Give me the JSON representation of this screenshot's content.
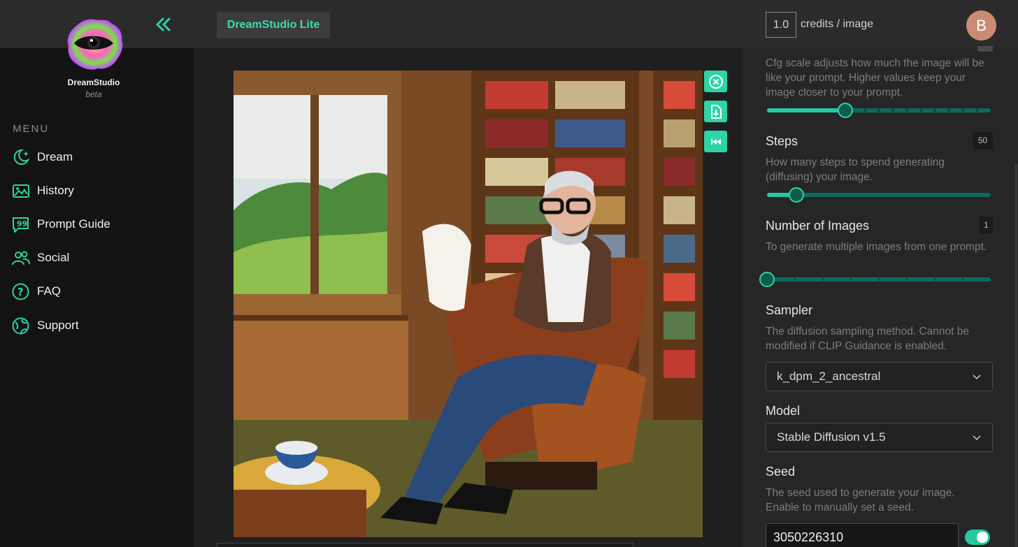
{
  "sidebar": {
    "brand_name": "DreamStudio",
    "brand_sub": "beta",
    "menu_heading": "MENU",
    "items": [
      {
        "label": "Dream",
        "icon": "dream-icon"
      },
      {
        "label": "History",
        "icon": "history-icon"
      },
      {
        "label": "Prompt Guide",
        "icon": "prompt-guide-icon"
      },
      {
        "label": "Social",
        "icon": "social-icon"
      },
      {
        "label": "FAQ",
        "icon": "faq-icon"
      },
      {
        "label": "Support",
        "icon": "support-icon"
      }
    ]
  },
  "header": {
    "app_label": "DreamStudio Lite"
  },
  "account": {
    "credits_value": "1.0",
    "credits_label": "credits / image",
    "avatar_initial": "B"
  },
  "settings": {
    "cfg": {
      "description": "Cfg scale adjusts how much the image will be like your prompt. Higher values keep your image closer to your prompt.",
      "level": 0.35
    },
    "steps": {
      "title": "Steps",
      "value": "50",
      "description": "How many steps to spend generating (diffusing) your image.",
      "level": 0.13
    },
    "images": {
      "title": "Number of Images",
      "value": "1",
      "description": "To generate multiple images from one prompt.",
      "level": 0.0
    },
    "sampler": {
      "title": "Sampler",
      "description": "The diffusion sampling method. Cannot be modified if CLIP Guidance is enabled.",
      "selected": "k_dpm_2_ancestral"
    },
    "model": {
      "title": "Model",
      "selected": "Stable Diffusion v1.5"
    },
    "seed": {
      "title": "Seed",
      "description": "The seed used to generate your image. Enable to manually set a seed.",
      "value": "3050226310",
      "enabled": true
    }
  },
  "image_actions": [
    "close-icon",
    "download-icon",
    "rewind-icon"
  ],
  "colors": {
    "accent": "#2ed3a6",
    "accent_dark": "#0c6b58",
    "sidebar_bg": "#131313",
    "panel_bg": "#262626"
  }
}
